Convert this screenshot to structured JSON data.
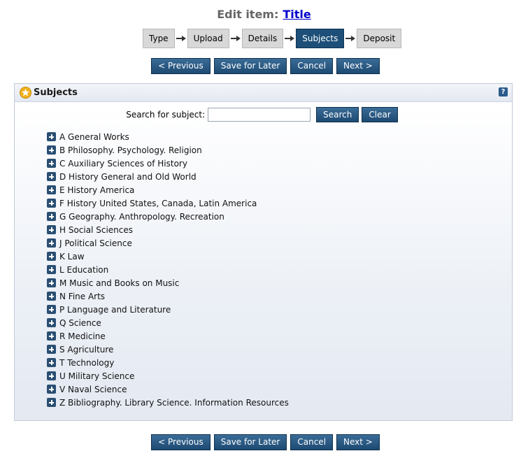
{
  "header": {
    "prefix": "Edit item:",
    "title_link": "Title"
  },
  "workflow": {
    "steps": [
      "Type",
      "Upload",
      "Details",
      "Subjects",
      "Deposit"
    ],
    "current": "Subjects"
  },
  "nav_buttons": {
    "previous": "< Previous",
    "save_for_later": "Save for Later",
    "cancel": "Cancel",
    "next": "Next >"
  },
  "panel": {
    "title": "Subjects",
    "help_label": "?"
  },
  "search": {
    "label": "Search for subject:",
    "value": "",
    "placeholder": "",
    "search_button": "Search",
    "clear_button": "Clear"
  },
  "subjects": [
    "A General Works",
    "B Philosophy. Psychology. Religion",
    "C Auxiliary Sciences of History",
    "D History General and Old World",
    "E History America",
    "F History United States, Canada, Latin America",
    "G Geography. Anthropology. Recreation",
    "H Social Sciences",
    "J Political Science",
    "K Law",
    "L Education",
    "M Music and Books on Music",
    "N Fine Arts",
    "P Language and Literature",
    "Q Science",
    "R Medicine",
    "S Agriculture",
    "T Technology",
    "U Military Science",
    "V Naval Science",
    "Z Bibliography. Library Science. Information Resources"
  ],
  "colors": {
    "accent": "#1d4f78",
    "link": "#0000cc",
    "step_inactive": "#d8d8d8"
  }
}
